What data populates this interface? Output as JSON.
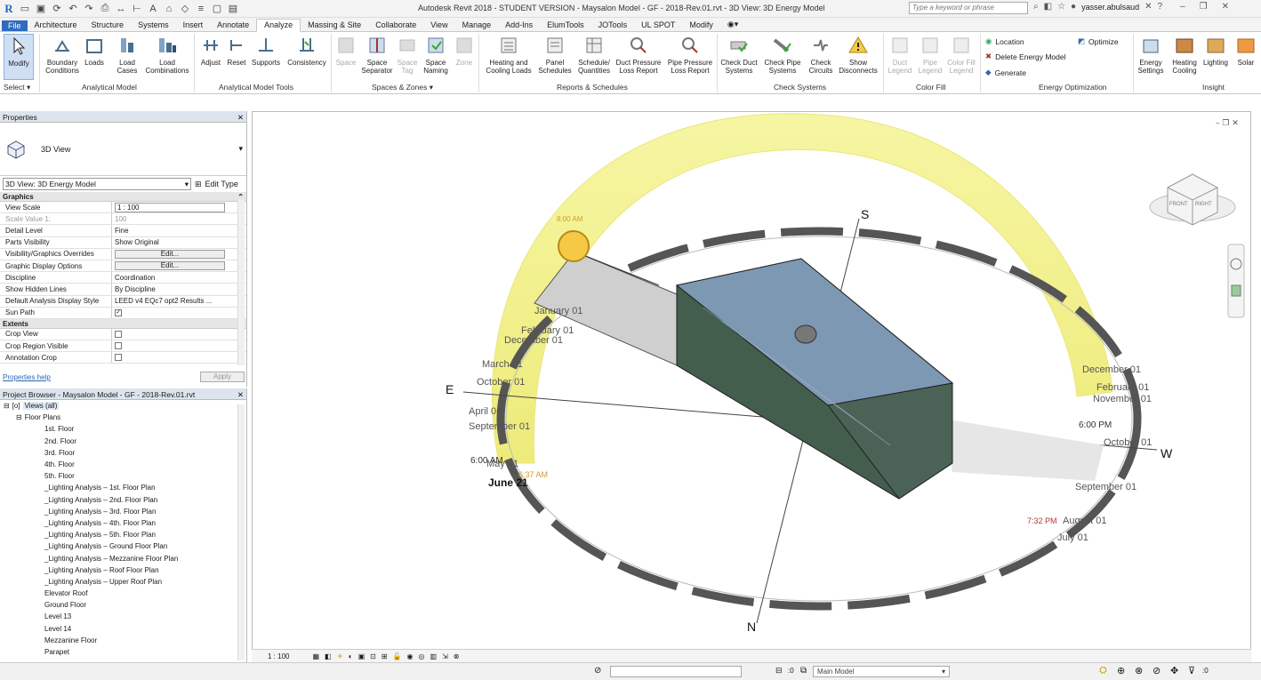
{
  "titlebar": {
    "title": "Autodesk Revit 2018 - STUDENT VERSION -    Maysalon Model - GF - 2018-Rev.01.rvt - 3D View: 3D Energy Model",
    "search_placeholder": "Type a keyword or phrase",
    "user": "yasser.abulsaud",
    "help": "?"
  },
  "menu": [
    "Architecture",
    "Structure",
    "Systems",
    "Insert",
    "Annotate",
    "Analyze",
    "Massing & Site",
    "Collaborate",
    "View",
    "Manage",
    "Add-Ins",
    "ElumTools",
    "JOTools",
    "UL SPOT",
    "Modify"
  ],
  "menu_file": "File",
  "ribbon": {
    "modify": "Modify",
    "select": "Select",
    "analytical_model": {
      "label": "Analytical Model",
      "buttons": [
        [
          "Boundary",
          "Conditions"
        ],
        [
          "Loads",
          ""
        ],
        [
          "Load",
          "Cases"
        ],
        [
          "Load",
          "Combinations"
        ]
      ]
    },
    "analytical_tools": {
      "label": "Analytical Model Tools",
      "buttons": [
        "Adjust",
        "Reset",
        "Supports",
        "Consistency"
      ]
    },
    "spaces": {
      "label": "Spaces & Zones",
      "buttons": [
        [
          "Space",
          ""
        ],
        [
          "Space",
          "Separator"
        ],
        [
          "Space",
          "Tag"
        ],
        [
          "Space",
          "Naming"
        ],
        [
          "Zone",
          ""
        ]
      ]
    },
    "reports": {
      "label": "Reports & Schedules",
      "buttons": [
        [
          "Heating and",
          "Cooling Loads"
        ],
        [
          "Panel",
          "Schedules"
        ],
        [
          "Schedule/",
          "Quantities"
        ],
        [
          "Duct Pressure",
          "Loss Report"
        ],
        [
          "Pipe Pressure",
          "Loss Report"
        ]
      ]
    },
    "check": {
      "label": "Check Systems",
      "buttons": [
        [
          "Check Duct",
          "Systems"
        ],
        [
          "Check Pipe",
          "Systems"
        ],
        [
          "Check",
          "Circuits"
        ],
        [
          "Show",
          "Disconnects"
        ]
      ]
    },
    "colorfill": {
      "label": "Color Fill",
      "buttons": [
        [
          "Duct",
          "Legend"
        ],
        [
          "Pipe",
          "Legend"
        ],
        [
          "Color Fill",
          "Legend"
        ]
      ]
    },
    "energy": {
      "label": "Energy Optimization",
      "location": "Location",
      "delete": "Delete Energy Model",
      "generate": "Generate",
      "optimize": "Optimize"
    },
    "insight": {
      "label": "Insight",
      "buttons": [
        [
          "Energy",
          "Settings"
        ],
        [
          "Heating",
          "Cooling"
        ],
        [
          "Lighting",
          ""
        ],
        [
          "Solar",
          ""
        ]
      ]
    }
  },
  "properties": {
    "title": "Properties",
    "type": "3D View",
    "instance": "3D View: 3D Energy Model",
    "edit_type": "Edit Type",
    "graphics_label": "Graphics",
    "rows": [
      [
        "View Scale",
        "1 : 100"
      ],
      [
        "Scale Value    1:",
        "100"
      ],
      [
        "Detail Level",
        "Fine"
      ],
      [
        "Parts Visibility",
        "Show Original"
      ],
      [
        "Visibility/Graphics Overrides",
        "Edit..."
      ],
      [
        "Graphic Display Options",
        "Edit..."
      ],
      [
        "Discipline",
        "Coordination"
      ],
      [
        "Show Hidden Lines",
        "By Discipline"
      ],
      [
        "Default Analysis Display Style",
        "LEED v4 EQc7 opt2 Results ..."
      ],
      [
        "Sun Path",
        "✓"
      ]
    ],
    "extents_label": "Extents",
    "extents": [
      [
        "Crop View",
        ""
      ],
      [
        "Crop Region Visible",
        ""
      ],
      [
        "Annotation Crop",
        ""
      ]
    ],
    "help": "Properties help",
    "apply": "Apply"
  },
  "browser": {
    "title": "Project Browser - Maysalon Model - GF - 2018-Rev.01.rvt",
    "views": "Views (all)",
    "floor_plans": "Floor Plans",
    "items": [
      "1st. Floor",
      "2nd. Floor",
      "3rd. Floor",
      "4th. Floor",
      "5th. Floor",
      "_Lighting Analysis – 1st. Floor Plan",
      "_Lighting Analysis – 2nd. Floor Plan",
      "_Lighting Analysis – 3rd. Floor Plan",
      "_Lighting Analysis – 4th. Floor Plan",
      "_Lighting Analysis – 5th. Floor Plan",
      "_Lighting Analysis – Ground Floor Plan",
      "_Lighting Analysis – Mezzanine Floor Plan",
      "_Lighting Analysis – Roof Floor Plan",
      "_Lighting Analysis – Upper Roof Plan",
      "Elevator Roof",
      "Ground Floor",
      "Level 13",
      "Level 14",
      "Mezzanine Floor",
      "Parapet"
    ]
  },
  "viewport": {
    "compass": {
      "S": "S",
      "E": "E",
      "W": "W",
      "N": "N"
    },
    "sun_time_top": "8:00 AM",
    "sun_times": [
      "6:00 PM",
      "7:32 PM",
      "6:37 AM",
      "6:00 AM"
    ],
    "dates_left": [
      "January 01",
      "December 01",
      "February 01",
      "November 01",
      "March 01",
      "October 01",
      "April 01",
      "September 01",
      "May 01",
      "August 01",
      "July 01",
      "June 21"
    ],
    "dates_right": [
      "December 01",
      "February 01",
      "November 01",
      "October 01",
      "September 01",
      "August 01",
      "July 01"
    ],
    "viewcube_faces": [
      "FRONT",
      "RIGHT"
    ],
    "scale": "1 : 100"
  },
  "status": {
    "workset": "Main Model",
    "zero": ":0"
  },
  "colors": {
    "accent": "#2e6cc0",
    "sunpath": "#f4f27a",
    "building": "#4a6e8a"
  }
}
